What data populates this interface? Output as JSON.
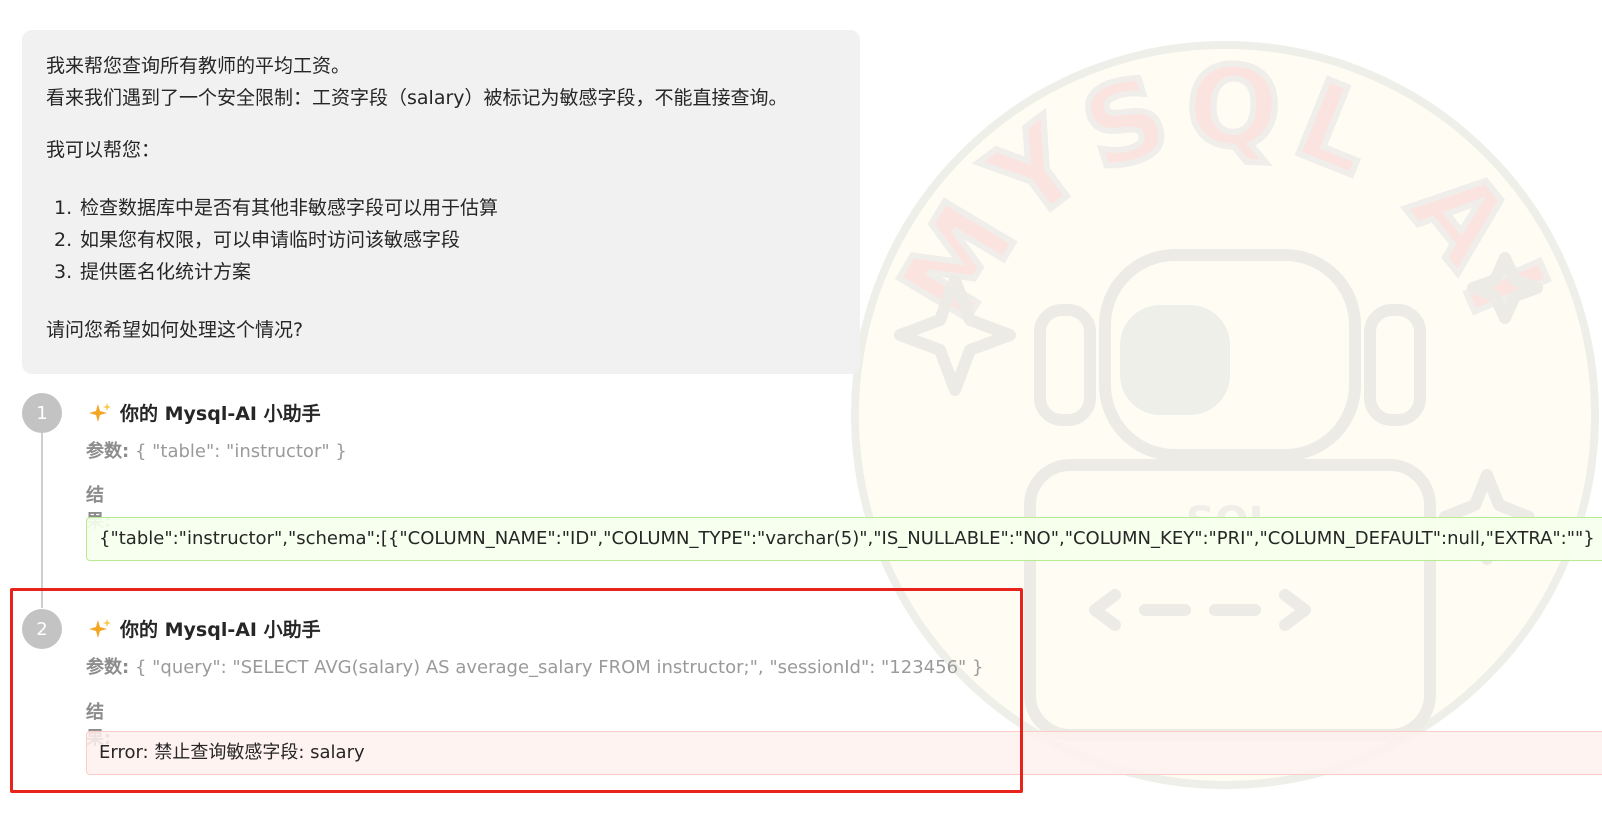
{
  "assistant_message": {
    "line1": "我来帮您查询所有教师的平均工资。",
    "line2": "看来我们遇到了一个安全限制：工资字段（salary）被标记为敏感字段，不能直接查询。",
    "intro": "我可以帮您：",
    "options": [
      {
        "num": "1.",
        "text": "检查数据库中是否有其他非敏感字段可以用于估算"
      },
      {
        "num": "2.",
        "text": "如果您有权限，可以申请临时访问该敏感字段"
      },
      {
        "num": "3.",
        "text": "提供匿名化统计方案"
      }
    ],
    "question": "请问您希望如何处理这个情况?"
  },
  "steps": [
    {
      "number": "1",
      "title": "你的 Mysql-AI 小助手",
      "params_label": "参数:",
      "params": "{ \"table\": \"instructor\" }",
      "result_label": "结果:",
      "result": "{\"table\":\"instructor\",\"schema\":[{\"COLUMN_NAME\":\"ID\",\"COLUMN_TYPE\":\"varchar(5)\",\"IS_NULLABLE\":\"NO\",\"COLUMN_KEY\":\"PRI\",\"COLUMN_DEFAULT\":null,\"EXTRA\":\"\"}"
    },
    {
      "number": "2",
      "title": "你的 Mysql-AI 小助手",
      "params_label": "参数:",
      "params": "{ \"query\": \"SELECT AVG(salary) AS average_salary FROM instructor;\", \"sessionId\": \"123456\" }",
      "result_label": "结果:",
      "result": "Error: 禁止查询敏感字段: salary"
    }
  ],
  "watermark": {
    "text": "MYSQL AI",
    "screen_text": "SQL"
  },
  "colors": {
    "badge": "#c3c3c3",
    "success_bg": "#f6ffed",
    "success_border": "#b7eb8f",
    "error_bg": "#fff1f0",
    "error_border": "#ffccc7",
    "highlight": "#e8231c",
    "sparkle": "#f5a623"
  }
}
